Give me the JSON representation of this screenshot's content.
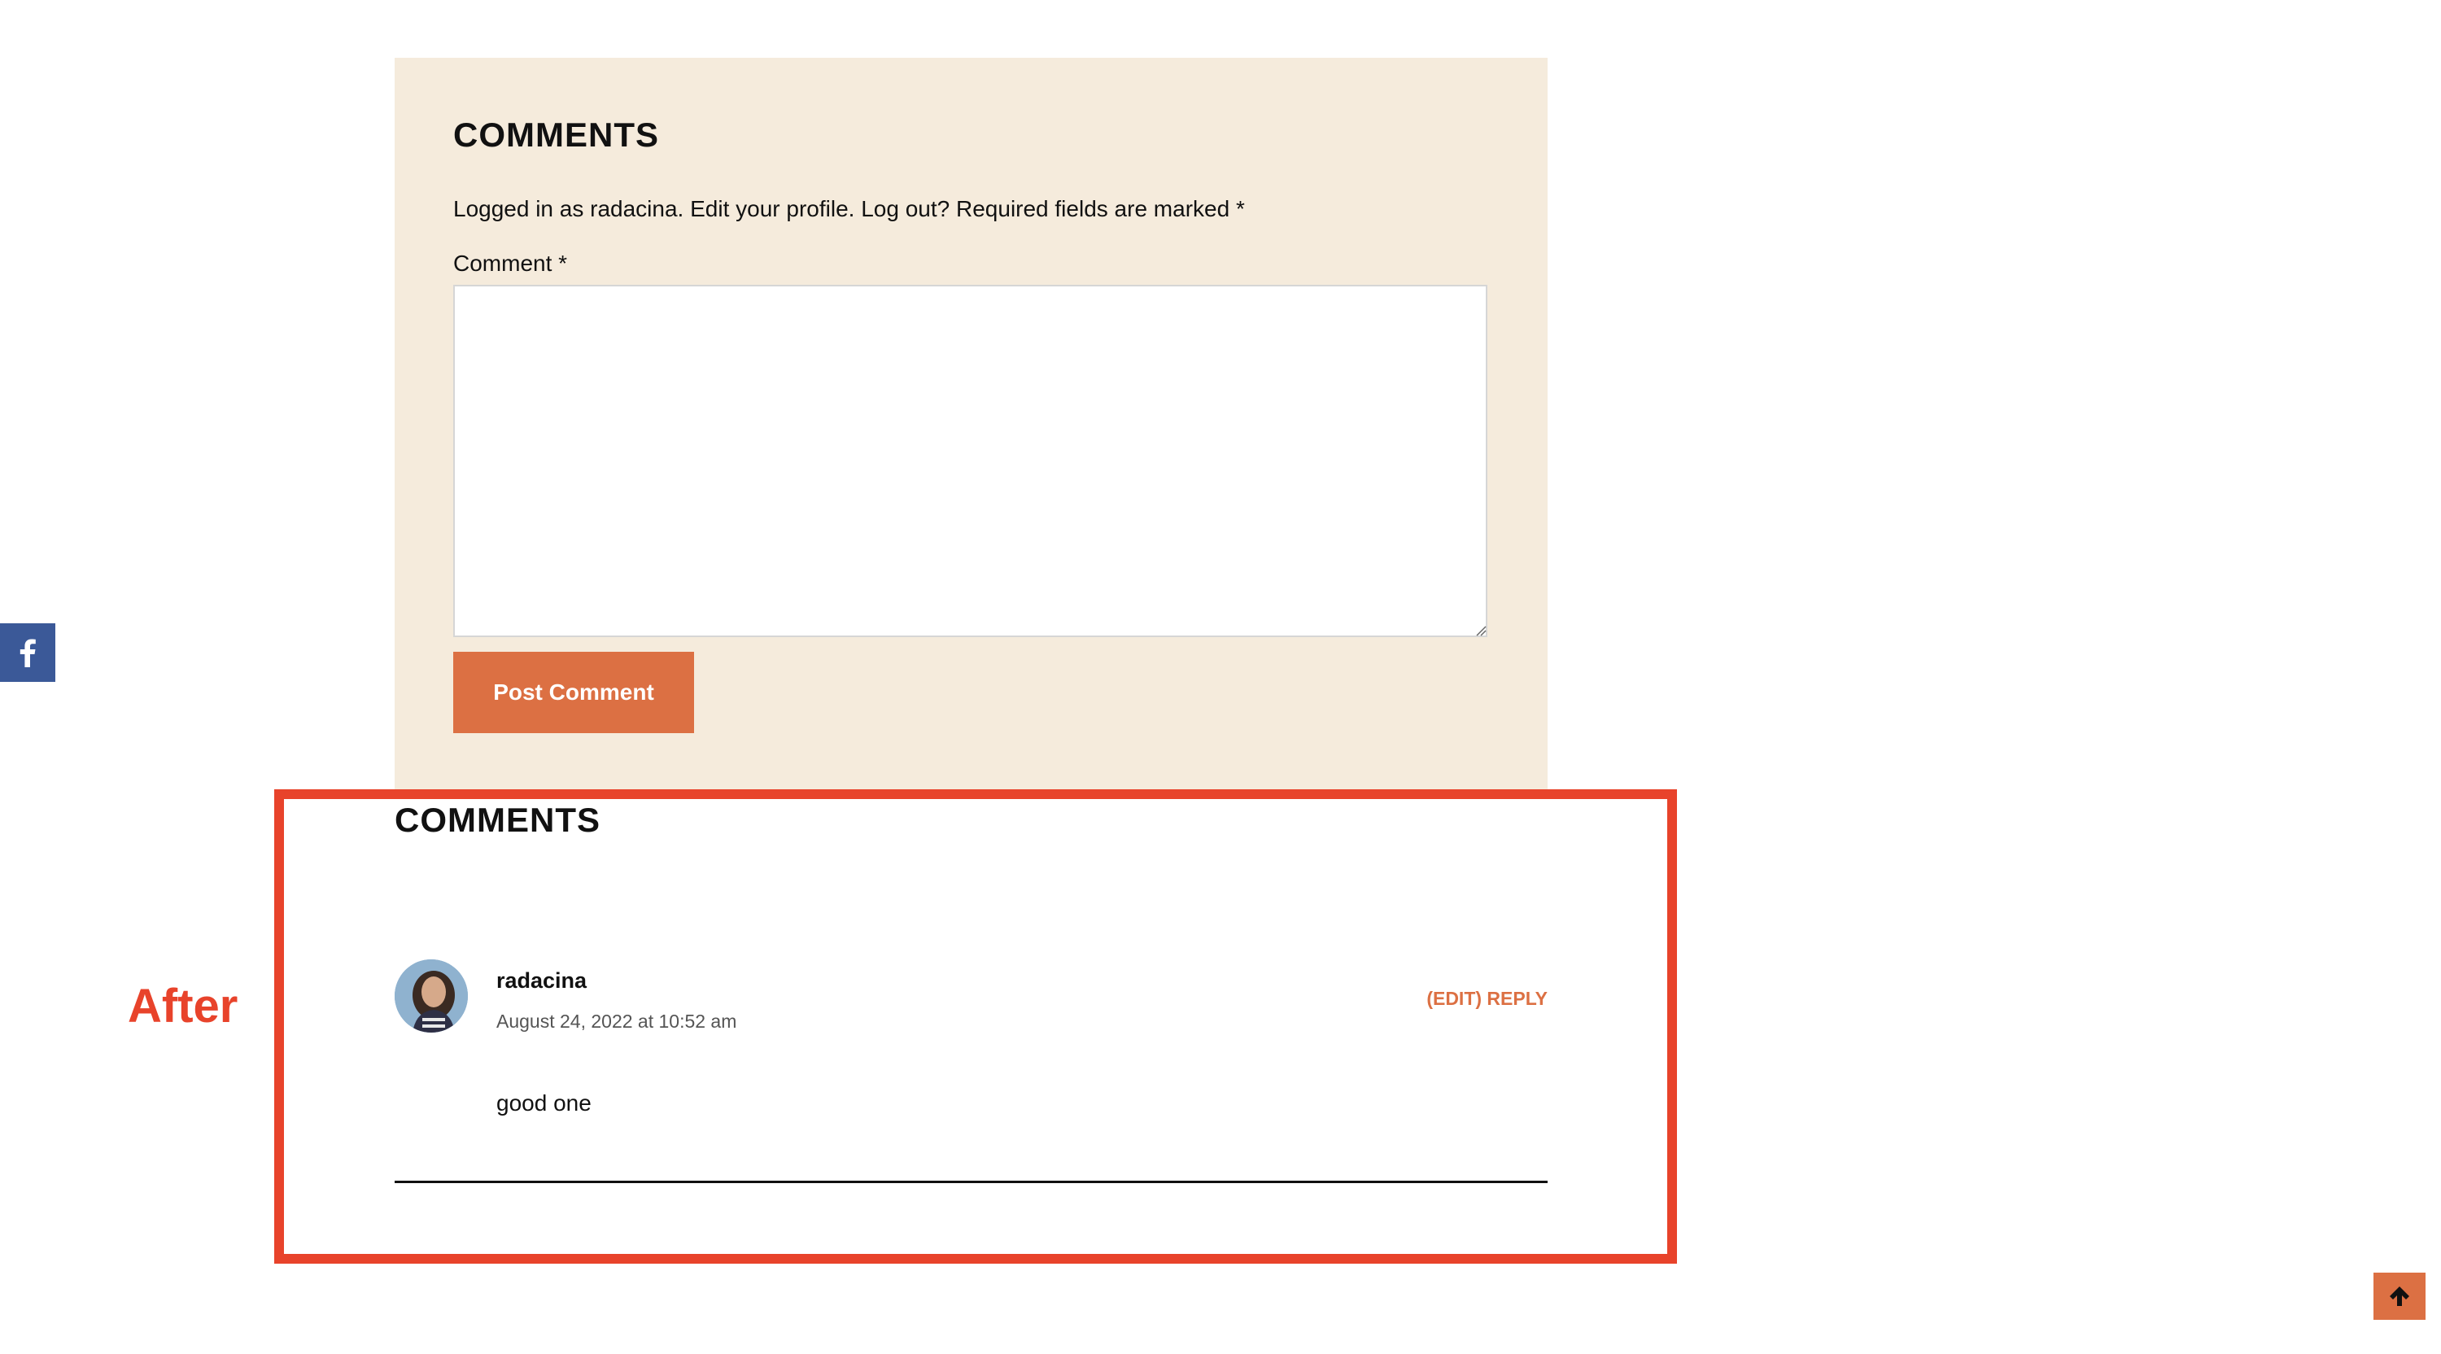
{
  "comment_form": {
    "title": "COMMENTS",
    "logged_in_prefix": "Logged in as radacina.",
    "edit_profile": "Edit your profile.",
    "log_out": "Log out?",
    "required_note": "Required fields are marked *",
    "comment_label": "Comment *",
    "comment_value": "",
    "submit_label": "Post Comment"
  },
  "comments_list": {
    "title": "COMMENTS",
    "items": [
      {
        "author": "radacina",
        "date": "August 24, 2022 at 10:52 am",
        "edit_label": "(EDIT)",
        "reply_label": "REPLY",
        "text": "good one"
      }
    ]
  },
  "annotation": {
    "label": "After"
  },
  "icons": {
    "facebook": "facebook-icon",
    "scroll_top": "arrow-up-icon",
    "avatar": "user-avatar"
  },
  "colors": {
    "panel_bg": "#f5ebdc",
    "accent": "#dc7043",
    "annotation": "#e8432b",
    "facebook": "#3b5998"
  }
}
